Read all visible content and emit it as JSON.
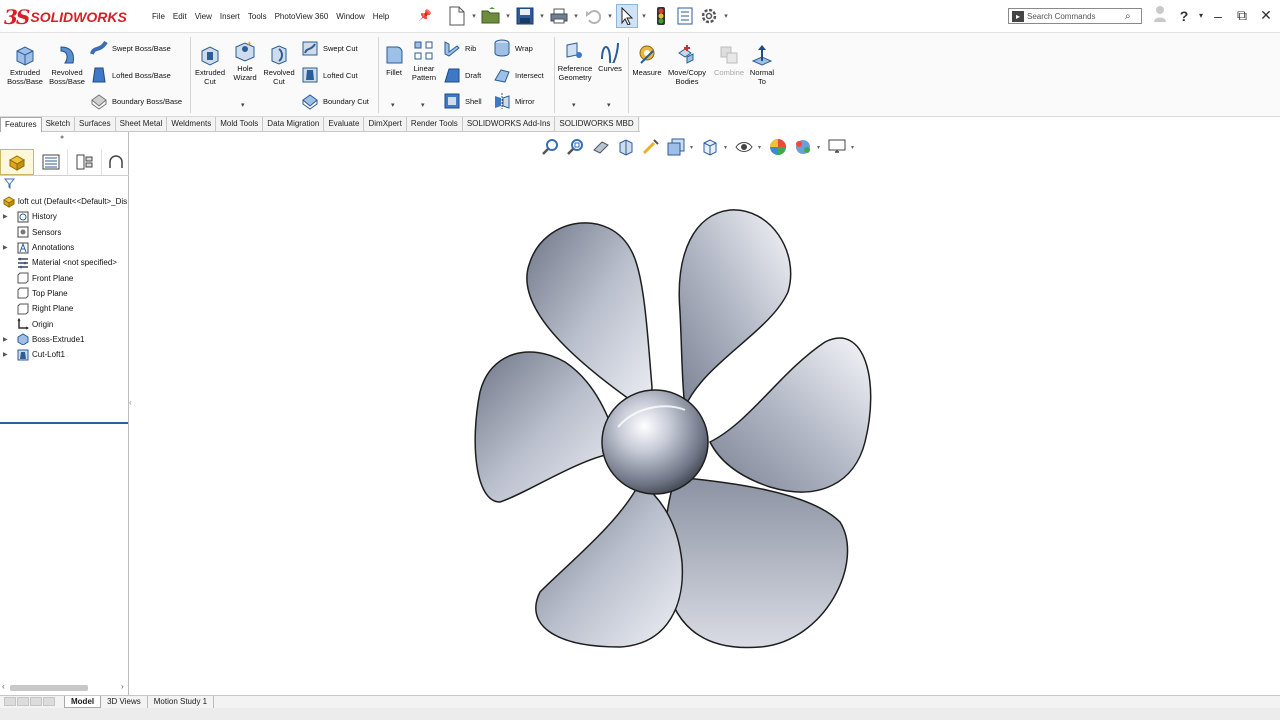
{
  "app": {
    "brand_ds": "3S",
    "brand_name": "SOLIDWORKS"
  },
  "menu": [
    "File",
    "Edit",
    "View",
    "Insert",
    "Tools",
    "PhotoView 360",
    "Window",
    "Help"
  ],
  "search": {
    "placeholder": "Search Commands"
  },
  "ribbon": {
    "extruded_boss": "Extruded\nBoss/Base",
    "revolved_boss": "Revolved\nBoss/Base",
    "swept_boss": "Swept Boss/Base",
    "lofted_boss": "Lofted Boss/Base",
    "boundary_boss": "Boundary Boss/Base",
    "extruded_cut": "Extruded\nCut",
    "hole_wizard": "Hole\nWizard",
    "revolved_cut": "Revolved\nCut",
    "swept_cut": "Swept Cut",
    "lofted_cut": "Lofted Cut",
    "boundary_cut": "Boundary Cut",
    "fillet": "Fillet",
    "linear_pattern": "Linear\nPattern",
    "rib": "Rib",
    "draft": "Draft",
    "shell": "Shell",
    "wrap": "Wrap",
    "intersect": "Intersect",
    "mirror": "Mirror",
    "reference_geometry": "Reference\nGeometry",
    "curves": "Curves",
    "measure": "Measure",
    "move_copy": "Move/Copy\nBodies",
    "combine": "Combine",
    "normal_to": "Normal\nTo"
  },
  "tabs": [
    "Features",
    "Sketch",
    "Surfaces",
    "Sheet Metal",
    "Weldments",
    "Mold Tools",
    "Data Migration",
    "Evaluate",
    "DimXpert",
    "Render Tools",
    "SOLIDWORKS Add-Ins",
    "SOLIDWORKS MBD"
  ],
  "tree": {
    "root": "loft cut  (Default<<Default>_Dis",
    "items": [
      "History",
      "Sensors",
      "Annotations",
      "Material <not specified>",
      "Front Plane",
      "Top Plane",
      "Right Plane",
      "Origin",
      "Boss-Extrude1",
      "Cut-Loft1"
    ]
  },
  "bottom_tabs": [
    "Model",
    "3D Views",
    "Motion Study 1"
  ],
  "colors": {
    "accent": "#2e6fbf",
    "brand": "#d81f26",
    "active_tab_bg": "#ffffff"
  }
}
